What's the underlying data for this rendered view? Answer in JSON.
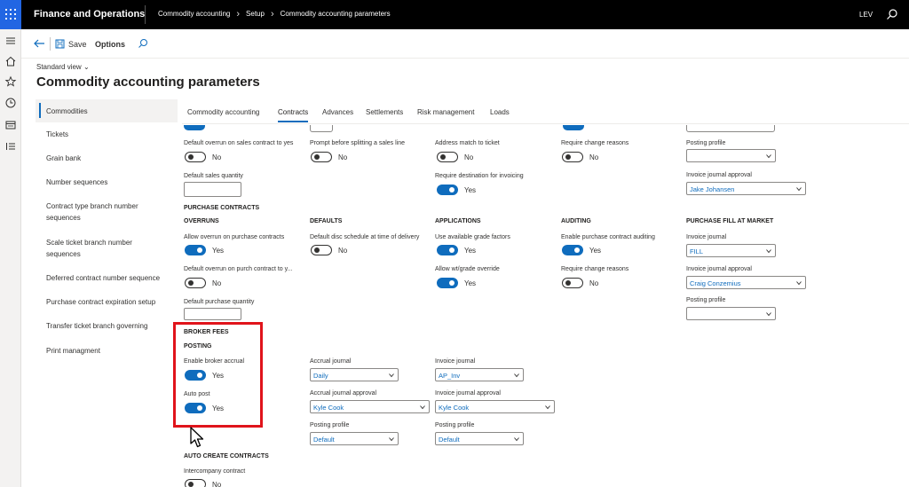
{
  "topbar": {
    "app_title": "Finance and Operations",
    "breadcrumb": [
      "Commodity accounting",
      "Setup",
      "Commodity accounting parameters"
    ],
    "user_initials": "LEV"
  },
  "actionbar": {
    "save_label": "Save",
    "options_label": "Options"
  },
  "header": {
    "view_selector": "Standard view",
    "page_title": "Commodity accounting parameters"
  },
  "vertical_tabs": [
    "Commodities",
    "Tickets",
    "Grain bank",
    "Number sequences",
    "Contract type branch number",
    "sequences",
    "Scale ticket branch number",
    "sequences",
    "Deferred contract number sequence",
    "Purchase contract expiration setup",
    "Transfer ticket branch governing",
    "Print managment"
  ],
  "tabs": [
    "Commodity accounting",
    "Contracts",
    "Advances",
    "Settlements",
    "Risk management",
    "Loads"
  ],
  "active_tab": "Contracts",
  "sales_top": {
    "overrun_label": "Default overrun on sales contract to yes",
    "overrun_value": "No",
    "prompt_split_label": "Prompt before splitting a sales line",
    "prompt_split_value": "No",
    "address_match_label": "Address match to ticket",
    "address_match_value": "No",
    "require_change_label": "Require change reasons",
    "require_change_value": "No",
    "posting_profile_label": "Posting profile",
    "posting_profile_value": "",
    "default_qty_label": "Default sales quantity",
    "require_dest_label": "Require destination for invoicing",
    "require_dest_value": "Yes",
    "invoice_approval_label": "Invoice journal approval",
    "invoice_approval_value": "Jake Johansen"
  },
  "purchase": {
    "section_title": "PURCHASE CONTRACTS",
    "overruns_header": "OVERRUNS",
    "defaults_header": "DEFAULTS",
    "applications_header": "APPLICATIONS",
    "auditing_header": "AUDITING",
    "fill_header": "PURCHASE FILL AT MARKET",
    "allow_overrun_label": "Allow overrun on purchase contracts",
    "allow_overrun_value": "Yes",
    "disc_schedule_label": "Default disc schedule at time of delivery",
    "disc_schedule_value": "No",
    "grade_factors_label": "Use available grade factors",
    "grade_factors_value": "Yes",
    "enable_audit_label": "Enable purchase contract auditing",
    "enable_audit_value": "Yes",
    "invoice_journal_label": "Invoice journal",
    "invoice_journal_value": "FILL",
    "overrun_purch_label": "Default overrun on purch contract to y...",
    "overrun_purch_value": "No",
    "wt_grade_label": "Allow wt/grade override",
    "wt_grade_value": "Yes",
    "require_change_label": "Require change reasons",
    "require_change_value": "No",
    "invoice_approval_label": "Invoice journal approval",
    "invoice_approval_value": "Craig Conzemius",
    "default_qty_label": "Default purchase quantity",
    "posting_profile_label": "Posting profile",
    "posting_profile_value": ""
  },
  "broker": {
    "section_title": "BROKER FEES",
    "posting_header": "POSTING",
    "enable_accrual_label": "Enable broker accrual",
    "enable_accrual_value": "Yes",
    "auto_post_label": "Auto post",
    "auto_post_value": "Yes",
    "accrual_journal_label": "Accrual journal",
    "accrual_journal_value": "Daily",
    "invoice_journal_label": "Invoice journal",
    "invoice_journal_value": "AP_Inv",
    "accrual_approval_label": "Accrual journal approval",
    "accrual_approval_value": "Kyle Cook",
    "invoice_approval_label": "Invoice journal approval",
    "invoice_approval_value": "Kyle Cook",
    "posting_profile1_label": "Posting profile",
    "posting_profile1_value": "Default",
    "posting_profile2_label": "Posting profile",
    "posting_profile2_value": "Default"
  },
  "auto_create": {
    "section_title": "AUTO CREATE CONTRACTS",
    "intercompany_label": "Intercompany contract",
    "intercompany_value": "No"
  },
  "colors": {
    "accent": "#0f6cbd",
    "highlight": "#e0141b",
    "topbar": "#000000"
  }
}
